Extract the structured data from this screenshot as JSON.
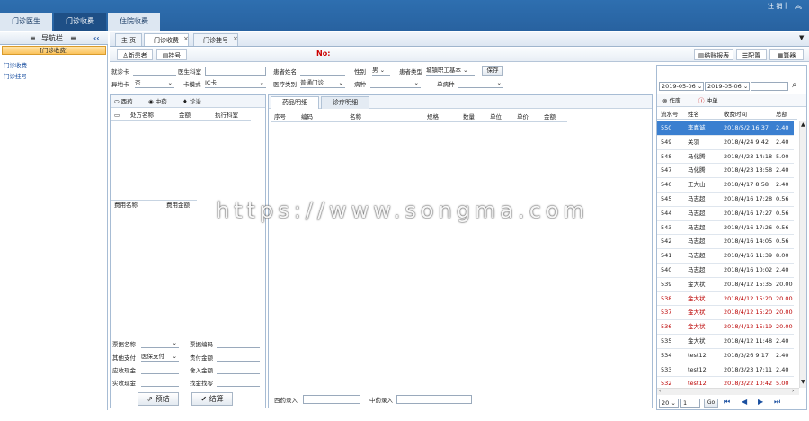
{
  "top_tabs": [
    "门诊医生",
    "门诊收费",
    "住院收费"
  ],
  "user": {
    "name": "注 销",
    "sep": "|"
  },
  "sidebar": {
    "title": "导航栏",
    "section": "[门诊收费]",
    "items": [
      "门诊收费",
      "门诊挂号"
    ]
  },
  "page_tabs": [
    "主 页",
    "门诊收费",
    "门诊挂号"
  ],
  "toolbar": {
    "new_patient": "新患者",
    "register": "挂号",
    "no_label": "No:",
    "stats": "结账报表",
    "config": "配置",
    "calc": "算器"
  },
  "form": {
    "visit_card": "就诊卡",
    "doctor_dept": "医生科室",
    "patient_name": "患者姓名",
    "gender_label": "性别",
    "gender_value": "男",
    "patient_type_label": "患者类型",
    "patient_type_value": "城镇职工基本",
    "save": "保存",
    "remote_card": "异地卡",
    "remote_value": "否",
    "card_mode_label": "卡模式",
    "card_mode_value": "IC卡",
    "medical_category": "医疗类别",
    "medical_value": "普通门诊",
    "disease": "病种",
    "single_disease": "单病种"
  },
  "med_tabs": [
    "西药",
    "中药",
    "诊治"
  ],
  "rx_headers": [
    "处方名称",
    "金额",
    "执行科室"
  ],
  "fee_headers": [
    "费用名称",
    "费用金额"
  ],
  "detail_tabs": [
    "药品明细",
    "诊疗明细"
  ],
  "detail_headers": [
    "序号",
    "编码",
    "名称",
    "规格",
    "数量",
    "单位",
    "单价",
    "金额"
  ],
  "bill": {
    "receipt_name": "票据名称",
    "receipt_code": "票据编码",
    "other_pay": "其他支付",
    "other_pay_value": "医保支付",
    "owed_amount": "责付金额",
    "cash_due": "应收现金",
    "rounding": "舍入金额",
    "cash_received": "实收现金",
    "change": "找金找零",
    "preset": "预结",
    "settle": "结算",
    "western_input": "西药录入",
    "chinese_input": "中药录入"
  },
  "right_panel": {
    "date_from": "2019-05-06",
    "date_to": "2019-05-06",
    "void": "作废",
    "reverse": "冲单",
    "headers": [
      "流水号",
      "姓名",
      "收费时间",
      "总额"
    ],
    "rows": [
      {
        "id": "550",
        "name": "李嘉诚",
        "time": "2018/5/2 16:37",
        "total": "2.40",
        "state": "selected"
      },
      {
        "id": "549",
        "name": "关羽",
        "time": "2018/4/24 9:42",
        "total": "2.40",
        "state": ""
      },
      {
        "id": "548",
        "name": "马化腾",
        "time": "2018/4/23 14:18",
        "total": "5.00",
        "state": ""
      },
      {
        "id": "547",
        "name": "马化腾",
        "time": "2018/4/23 13:58",
        "total": "2.40",
        "state": ""
      },
      {
        "id": "546",
        "name": "王大山",
        "time": "2018/4/17 8:58",
        "total": "2.40",
        "state": ""
      },
      {
        "id": "545",
        "name": "马志超",
        "time": "2018/4/16 17:28",
        "total": "0.56",
        "state": ""
      },
      {
        "id": "544",
        "name": "马志超",
        "time": "2018/4/16 17:27",
        "total": "0.56",
        "state": ""
      },
      {
        "id": "543",
        "name": "马志超",
        "time": "2018/4/16 17:26",
        "total": "0.56",
        "state": ""
      },
      {
        "id": "542",
        "name": "马志超",
        "time": "2018/4/16 14:05",
        "total": "0.56",
        "state": ""
      },
      {
        "id": "541",
        "name": "马志超",
        "time": "2018/4/16 11:39",
        "total": "8.00",
        "state": ""
      },
      {
        "id": "540",
        "name": "马志超",
        "time": "2018/4/16 10:02",
        "total": "2.40",
        "state": ""
      },
      {
        "id": "539",
        "name": "金大状",
        "time": "2018/4/12 15:35",
        "total": "20.00",
        "state": ""
      },
      {
        "id": "538",
        "name": "金大状",
        "time": "2018/4/12 15:20",
        "total": "20.00",
        "state": "void"
      },
      {
        "id": "537",
        "name": "金大状",
        "time": "2018/4/12 15:20",
        "total": "20.00",
        "state": "void"
      },
      {
        "id": "536",
        "name": "金大状",
        "time": "2018/4/12 15:19",
        "total": "20.00",
        "state": "void"
      },
      {
        "id": "535",
        "name": "金大状",
        "time": "2018/4/12 11:48",
        "total": "2.40",
        "state": ""
      },
      {
        "id": "534",
        "name": "test12",
        "time": "2018/3/26 9:17",
        "total": "2.40",
        "state": ""
      },
      {
        "id": "533",
        "name": "test12",
        "time": "2018/3/23 17:11",
        "total": "2.40",
        "state": ""
      },
      {
        "id": "532",
        "name": "test12",
        "time": "2018/3/22 10:42",
        "total": "5.00",
        "state": "void"
      }
    ],
    "pager": {
      "page_size": "20",
      "page": "1",
      "go": "Go"
    }
  },
  "watermark": "https://www.songma.com"
}
